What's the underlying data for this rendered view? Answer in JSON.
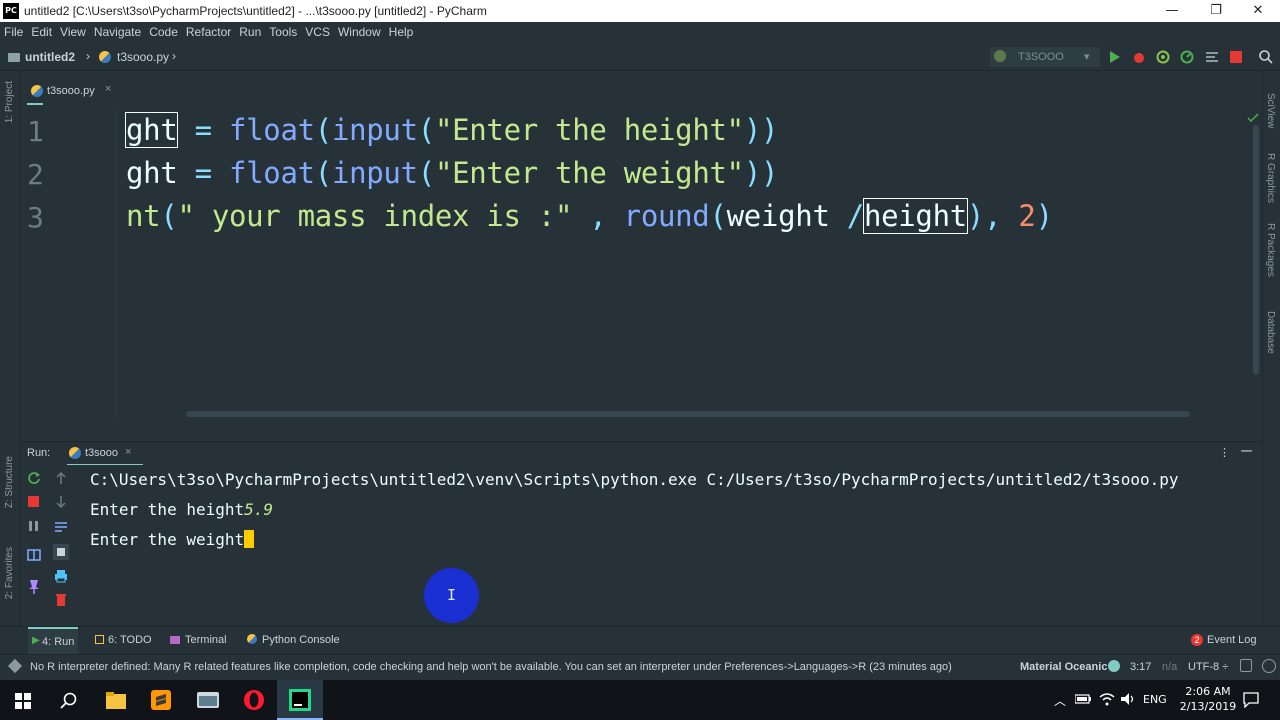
{
  "window": {
    "logo": "PC",
    "title": "untitled2 [C:\\Users\\t3so\\PycharmProjects\\untitled2] - ...\\t3sooo.py [untitled2] - PyCharm",
    "minimize": "—",
    "maximize": "❐",
    "close": "✕"
  },
  "menu": [
    "File",
    "Edit",
    "View",
    "Navigate",
    "Code",
    "Refactor",
    "Run",
    "Tools",
    "VCS",
    "Window",
    "Help"
  ],
  "breadcrumb": {
    "project": "untitled2",
    "file": "t3sooo.py",
    "sep": "›"
  },
  "run_config": {
    "name": "T3SOOO",
    "arrow": "▾"
  },
  "left_strip": {
    "project": "1: Project",
    "structure": "Z: Structure",
    "favorites": "2: Favorites"
  },
  "right_strip": {
    "scview": "SciView",
    "rgraphics": "R Graphics",
    "rpackages": "R Packages",
    "database": "Database"
  },
  "editor_tab": {
    "label": "t3sooo.py",
    "close": "×"
  },
  "code_lines": [
    {
      "num": "1",
      "a": "ght",
      "b": " = ",
      "c": "float",
      "d": "(",
      "e": "input",
      "f": "(",
      "g": "\"Enter the height\"",
      "h": "))"
    },
    {
      "num": "2",
      "a": "ght",
      "b": " = ",
      "c": "float",
      "d": "(",
      "e": "input",
      "f": "(",
      "g": "\"Enter the weight\"",
      "h": "))"
    },
    {
      "num": "3",
      "a": "nt",
      "b": "(",
      "c": "\" your mass index is :\"",
      "d": " , ",
      "e": "round",
      "f": "(",
      "g": "weight ",
      "h": "/",
      "i": "height",
      "j": "), ",
      "k": "2",
      "l": ")"
    }
  ],
  "run_panel": {
    "label": "Run:",
    "tab": "t3sooo",
    "close": "×",
    "menu_icon": "⋮",
    "hide_icon": "—"
  },
  "console": {
    "line1": "C:\\Users\\t3so\\PycharmProjects\\untitled2\\venv\\Scripts\\python.exe C:/Users/t3so/PycharmProjects/untitled2/t3sooo.py",
    "line2_prompt": "Enter the height",
    "line2_input": "5.9",
    "line3_prompt": "Enter the weight",
    "cursor_glyph": "I"
  },
  "bottom_tabs": [
    {
      "label": "4: Run"
    },
    {
      "label": "6: TODO"
    },
    {
      "label": "Terminal"
    },
    {
      "label": "Python Console"
    }
  ],
  "event_log": {
    "count": "2",
    "label": "Event Log"
  },
  "status": {
    "message": "No R interpreter defined: Many R related features like completion, code checking and help won't be available. You can set an interpreter under Preferences->Languages->R (23 minutes ago)",
    "theme": "Material Oceanic",
    "position": "3:17",
    "na": "n/a",
    "encoding": "UTF-8 ÷"
  },
  "taskbar": {
    "lang": "ENG",
    "time": "2:06 AM",
    "date": "2/13/2019"
  },
  "colors": {
    "accent": "#80cbc4",
    "bg": "#263238",
    "cursor_circle": "#1a2fd1"
  }
}
